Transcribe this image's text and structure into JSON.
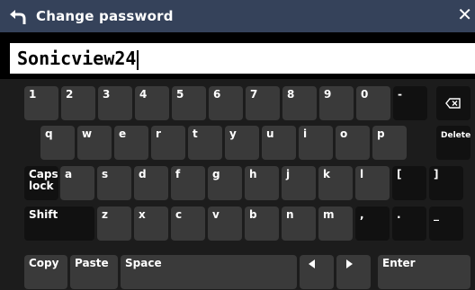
{
  "title": "Change password",
  "password_value": "Sonicview24",
  "rows": {
    "numbers": [
      "1",
      "2",
      "3",
      "4",
      "5",
      "6",
      "7",
      "8",
      "9",
      "0",
      "-"
    ],
    "qwerty": [
      "q",
      "w",
      "e",
      "r",
      "t",
      "y",
      "u",
      "i",
      "o",
      "p"
    ],
    "asdf": [
      "a",
      "s",
      "d",
      "f",
      "g",
      "h",
      "j",
      "k",
      "l",
      "[",
      "]"
    ],
    "zxcv": [
      "z",
      "x",
      "c",
      "v",
      "b",
      "n",
      "m",
      ",",
      ".",
      "_"
    ]
  },
  "labels": {
    "delete": "Delete",
    "caps_lock": "Caps\nlock",
    "shift": "Shift",
    "copy": "Copy",
    "paste": "Paste",
    "space": "Space",
    "enter": "Enter"
  },
  "icons": {
    "back": "back-arrow-icon",
    "close": "close-icon",
    "backspace": "backspace-icon",
    "left": "arrow-left-icon",
    "right": "arrow-right-icon"
  }
}
